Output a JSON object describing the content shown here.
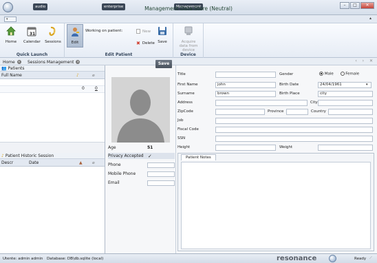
{
  "titlebar": {
    "title": "Management Data Store (Neutral)",
    "tags": [
      "audio",
      "enterprise",
      "Management"
    ]
  },
  "ribbon": {
    "quick_launch": {
      "label": "Quick Launch",
      "home": "Home",
      "calendar": "Calendar",
      "calendar_day": "31",
      "sessions": "Sessions"
    },
    "edit_patient": {
      "label": "Edit Patient",
      "edit": "Edit",
      "working_on": "Working on patient:",
      "new": "New",
      "delete": "Delete",
      "save": "Save"
    },
    "device": {
      "label": "Device",
      "acquire": "Acquire data from device"
    }
  },
  "tabs": [
    {
      "label": "Home"
    },
    {
      "label": "Sessions Management"
    }
  ],
  "patients": {
    "header": "Patients",
    "col_fullname": "Full Name",
    "row_count": "0",
    "row_flag": "0"
  },
  "history": {
    "header": "Patient Historic Session",
    "col_descr": "Descr",
    "col_date": "Date"
  },
  "center": {
    "age_label": "Age",
    "age_value": "51",
    "privacy_label": "Privacy Accepted",
    "phone_label": "Phone",
    "mobile_label": "Mobile Phone",
    "email_label": "Email",
    "save_label": "Save"
  },
  "form": {
    "title_label": "Title",
    "gender_label": "Gender",
    "male_label": "Male",
    "female_label": "Female",
    "firstname_label": "First Name",
    "firstname_value": "john",
    "birthdate_label": "Birth Date",
    "birthdate_value": "24/04/1961",
    "surname_label": "Surname",
    "surname_value": "brown",
    "birthplace_label": "Birth Place",
    "birthplace_value": "city",
    "address_label": "Address",
    "city_label": "City",
    "zipcode_label": "ZipCode",
    "province_label": "Province",
    "country_label": "Country",
    "job_label": "Job",
    "fiscal_label": "Fiscal Code",
    "ssn_label": "SSN",
    "height_label": "Height",
    "weight_label": "Weight",
    "notes_tab": "Patient Notes"
  },
  "status": {
    "user": "Utente: admin admin",
    "database": "Database: DB\\db.sqlite (local)",
    "brand": "resonance",
    "ready": "Ready"
  },
  "colors": {
    "accent": "#3b6ea8",
    "brand": "#5a5f68"
  }
}
